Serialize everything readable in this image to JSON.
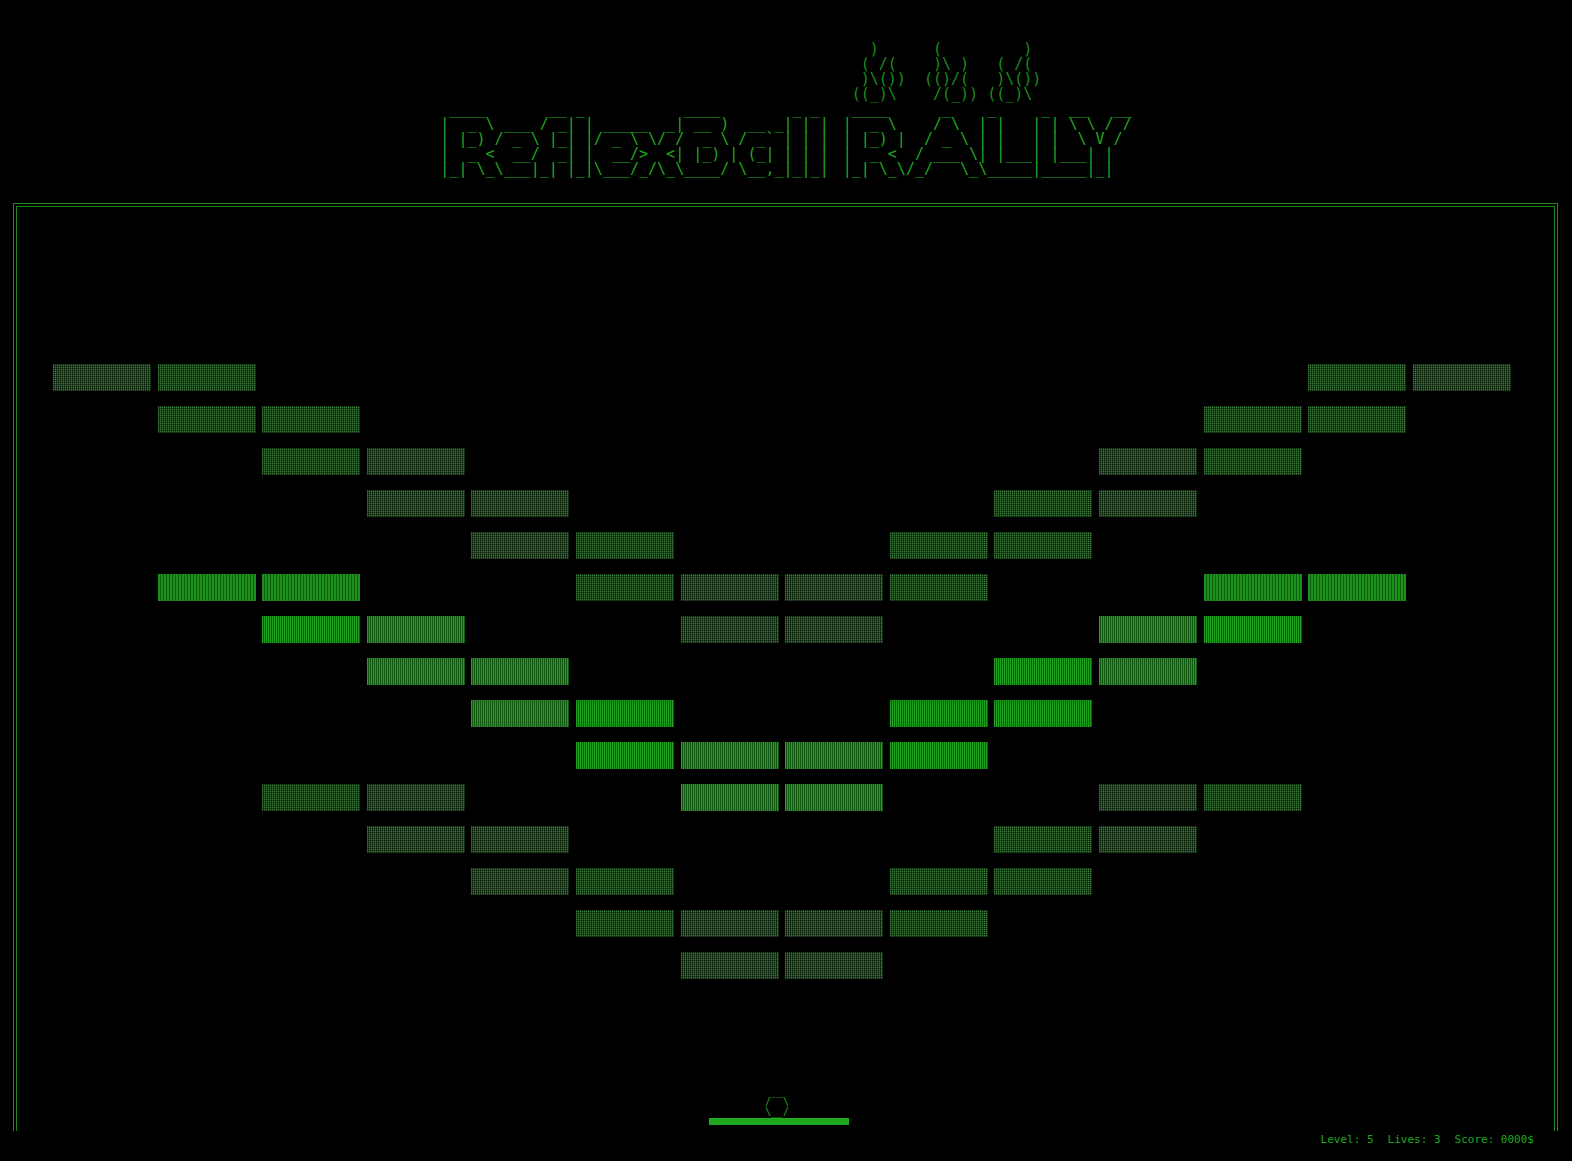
{
  "title": {
    "word": [
      " ____       __ _           ____        _ _ ",
      "|  _ \\ ___ / _| | _____  _| __ )  __ _| | |",
      "| |_) / _ \\ |_| |/ _ \\ \\/ /  _ \\ / _` | | |",
      "|  _ <  __/  _| |  __/>  <| |_) | (_| | | |",
      "|_| \\_\\___|_| |_|\\___/_/\\_\\____/ \\__,_|_|_|"
    ],
    "flames": [
      "   )      (         )",
      "  ( /(    )\\ )   ( /( ",
      "  )\\())  (()/(   )\\())",
      " ((_)\\    /(_)) ((_)\\ "
    ],
    "rally": [
      " ____      _    _     _  __   __",
      "|  _ \\    / \\  | |   | | \\ \\ / /",
      "| |_) |  / _ \\ | |   | |  \\ V / ",
      "|  _ <  / ___ \\| |___| |___| |  ",
      "|_| \\_\\/_/   \\_\\_____|_____|_|  "
    ]
  },
  "bricks": {
    "hits": [
      [
        1,
        1,
        0,
        0,
        0,
        0,
        0,
        0,
        0,
        0,
        0,
        0,
        1,
        1
      ],
      [
        0,
        1,
        1,
        0,
        0,
        0,
        0,
        0,
        0,
        0,
        0,
        1,
        1,
        0
      ],
      [
        0,
        0,
        1,
        1,
        0,
        0,
        0,
        0,
        0,
        0,
        1,
        1,
        0,
        0
      ],
      [
        0,
        0,
        0,
        1,
        1,
        0,
        0,
        0,
        0,
        1,
        1,
        0,
        0,
        0
      ],
      [
        0,
        0,
        0,
        0,
        1,
        1,
        0,
        0,
        1,
        1,
        0,
        0,
        0,
        0
      ],
      [
        0,
        3,
        3,
        0,
        0,
        1,
        1,
        1,
        1,
        0,
        0,
        3,
        3,
        0
      ],
      [
        0,
        0,
        2,
        2,
        0,
        0,
        1,
        1,
        0,
        0,
        2,
        2,
        0,
        0
      ],
      [
        0,
        0,
        0,
        2,
        2,
        0,
        0,
        0,
        0,
        2,
        2,
        0,
        0,
        0
      ],
      [
        0,
        0,
        0,
        0,
        2,
        2,
        0,
        0,
        2,
        2,
        0,
        0,
        0,
        0
      ],
      [
        0,
        0,
        0,
        0,
        0,
        2,
        2,
        2,
        2,
        0,
        0,
        0,
        0,
        0
      ],
      [
        0,
        0,
        1,
        1,
        0,
        0,
        2,
        2,
        0,
        0,
        1,
        1,
        0,
        0
      ],
      [
        0,
        0,
        0,
        1,
        1,
        0,
        0,
        0,
        0,
        1,
        1,
        0,
        0,
        0
      ],
      [
        0,
        0,
        0,
        0,
        1,
        1,
        0,
        0,
        1,
        1,
        0,
        0,
        0,
        0
      ],
      [
        0,
        0,
        0,
        0,
        0,
        1,
        1,
        1,
        1,
        0,
        0,
        0,
        0,
        0
      ],
      [
        0,
        0,
        0,
        0,
        0,
        0,
        1,
        1,
        0,
        0,
        0,
        0,
        0,
        0
      ]
    ]
  },
  "ball": [
    " __ ",
    "/  \\",
    "\\__/"
  ],
  "status": [
    {
      "label": "Level:",
      "value": "5"
    },
    {
      "label": "Lives:",
      "value": "3"
    },
    {
      "label": "Score:",
      "value": "0000$"
    }
  ]
}
